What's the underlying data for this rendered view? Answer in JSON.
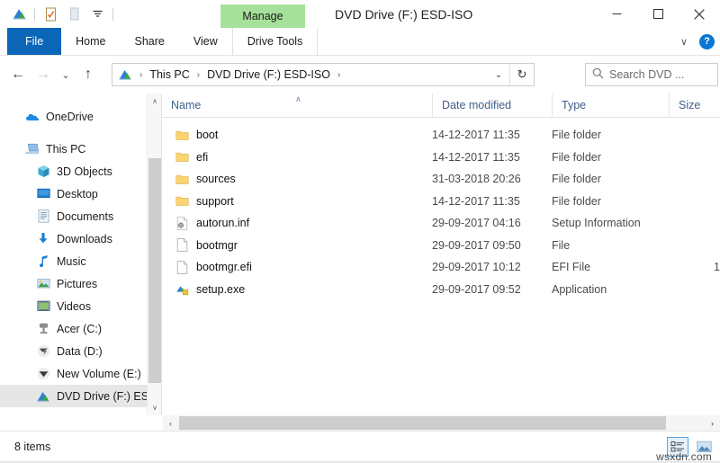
{
  "window": {
    "title": "DVD Drive (F:) ESD-ISO",
    "minimize_label": "—",
    "maximize_label": "☐",
    "close_label": "✕"
  },
  "quick_access": {
    "items": [
      {
        "name": "dvd-drive-icon",
        "label": ""
      },
      {
        "name": "properties-icon",
        "label": ""
      },
      {
        "name": "new-folder-icon",
        "label": ""
      },
      {
        "name": "customize-qat-icon",
        "label": "⩟"
      }
    ]
  },
  "ribbon": {
    "contextual_group_label": "Manage",
    "tabs": [
      {
        "label": "File",
        "name": "tab-file"
      },
      {
        "label": "Home",
        "name": "tab-home"
      },
      {
        "label": "Share",
        "name": "tab-share"
      },
      {
        "label": "View",
        "name": "tab-view"
      },
      {
        "label": "Drive Tools",
        "name": "tab-drive-tools"
      }
    ],
    "collapse_label": "∨",
    "help_label": "?",
    "accent_blue": "#0b66b8",
    "contextual_green": "#a6e19b"
  },
  "navbar": {
    "back_label": "←",
    "forward_label": "→",
    "recent_label": "⌄",
    "up_label": "↑",
    "breadcrumb_icon": "dvd-drive-icon",
    "breadcrumbs": [
      {
        "label": "This PC"
      },
      {
        "label": "DVD Drive (F:) ESD-ISO"
      }
    ],
    "separator": "›",
    "dropdown_label": "⌄",
    "refresh_label": "↻"
  },
  "search": {
    "placeholder": "Search DVD ...",
    "icon": "search-icon"
  },
  "sidebar": {
    "items": [
      {
        "label": "OneDrive",
        "icon": "onedrive-cloud-icon",
        "level": 1,
        "selected": false
      },
      {
        "label": "This PC",
        "icon": "this-pc-icon",
        "level": 1,
        "selected": false
      },
      {
        "label": "3D Objects",
        "icon": "3d-objects-icon",
        "level": 2,
        "selected": false
      },
      {
        "label": "Desktop",
        "icon": "desktop-icon",
        "level": 2,
        "selected": false
      },
      {
        "label": "Documents",
        "icon": "documents-icon",
        "level": 2,
        "selected": false
      },
      {
        "label": "Downloads",
        "icon": "downloads-icon",
        "level": 2,
        "selected": false
      },
      {
        "label": "Music",
        "icon": "music-icon",
        "level": 2,
        "selected": false
      },
      {
        "label": "Pictures",
        "icon": "pictures-icon",
        "level": 2,
        "selected": false
      },
      {
        "label": "Videos",
        "icon": "videos-icon",
        "level": 2,
        "selected": false
      },
      {
        "label": "Acer (C:)",
        "icon": "hard-drive-icon",
        "level": 2,
        "selected": false
      },
      {
        "label": "Data (D:)",
        "icon": "hard-drive-icon",
        "level": 2,
        "selected": false
      },
      {
        "label": "New Volume (E:)",
        "icon": "hard-drive-icon",
        "level": 2,
        "selected": false
      },
      {
        "label": "DVD Drive (F:) ES",
        "icon": "dvd-drive-icon",
        "level": 2,
        "selected": true
      }
    ],
    "scroll_up": "∧",
    "scroll_down": "∨"
  },
  "filelist": {
    "columns": [
      {
        "label": "Name",
        "name": "column-header-name"
      },
      {
        "label": "Date modified",
        "name": "column-header-date-modified"
      },
      {
        "label": "Type",
        "name": "column-header-type"
      },
      {
        "label": "Size",
        "name": "column-header-size"
      }
    ],
    "sort_indicator": "∧",
    "rows": [
      {
        "name": "boot",
        "date": "14-12-2017 11:35",
        "type": "File folder",
        "size": "",
        "icon": "folder-icon"
      },
      {
        "name": "efi",
        "date": "14-12-2017 11:35",
        "type": "File folder",
        "size": "",
        "icon": "folder-icon"
      },
      {
        "name": "sources",
        "date": "31-03-2018 20:26",
        "type": "File folder",
        "size": "",
        "icon": "folder-icon"
      },
      {
        "name": "support",
        "date": "14-12-2017 11:35",
        "type": "File folder",
        "size": "",
        "icon": "folder-icon"
      },
      {
        "name": "autorun.inf",
        "date": "29-09-2017 04:16",
        "type": "Setup Information",
        "size": "",
        "icon": "setup-information-icon"
      },
      {
        "name": "bootmgr",
        "date": "29-09-2017 09:50",
        "type": "File",
        "size": "",
        "icon": "generic-file-icon"
      },
      {
        "name": "bootmgr.efi",
        "date": "29-09-2017 10:12",
        "type": "EFI File",
        "size": "1",
        "icon": "generic-file-icon"
      },
      {
        "name": "setup.exe",
        "date": "29-09-2017 09:52",
        "type": "Application",
        "size": "",
        "icon": "application-exe-icon"
      }
    ]
  },
  "hscrollbar": {
    "left_label": "‹",
    "right_label": "›"
  },
  "statusbar": {
    "item_count": "8 items",
    "view_details_icon": "details-view-icon",
    "view_large_icons_icon": "large-icons-view-icon",
    "watermark": "wsxdn.com"
  }
}
